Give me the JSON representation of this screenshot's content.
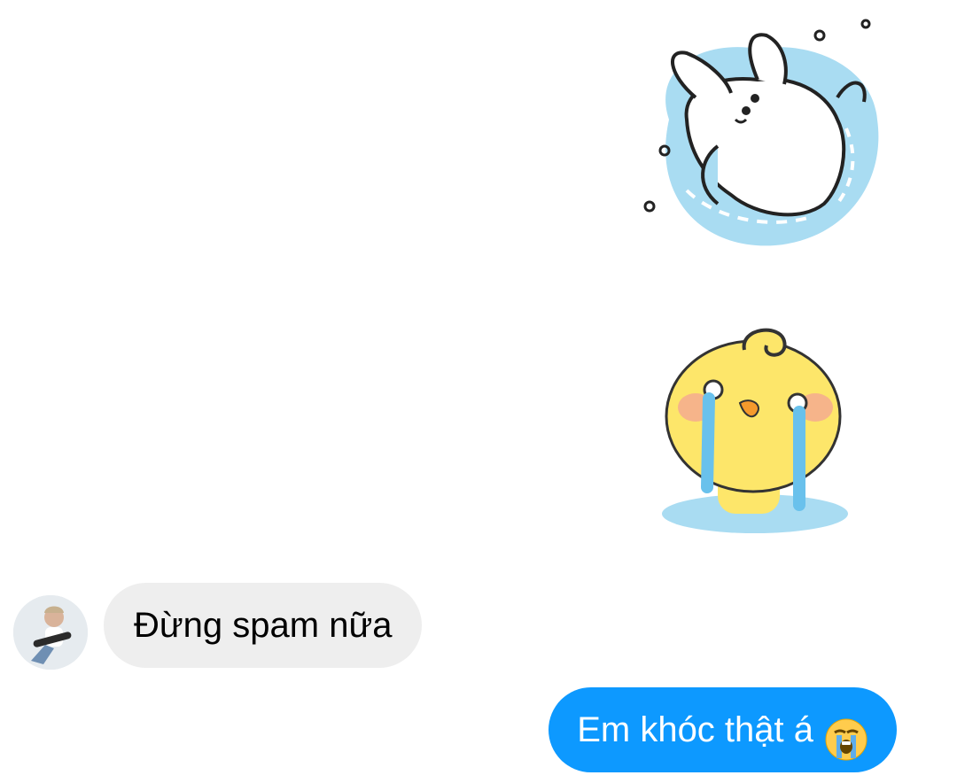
{
  "messages": [
    {
      "type": "sticker",
      "sender": "me",
      "sticker_icon": "crying-bunny-sticker"
    },
    {
      "type": "sticker",
      "sender": "me",
      "sticker_icon": "crying-chick-sticker"
    },
    {
      "type": "text",
      "sender": "other",
      "text": "Đừng spam nữa",
      "avatar_icon": "contact-avatar"
    },
    {
      "type": "text",
      "sender": "me",
      "text": "Em khóc thật á",
      "emoji_icon": "loudly-crying-face-emoji"
    }
  ],
  "colors": {
    "outgoing_bubble": "#0d99ff",
    "incoming_bubble": "#eeeeee",
    "background": "#ffffff"
  }
}
